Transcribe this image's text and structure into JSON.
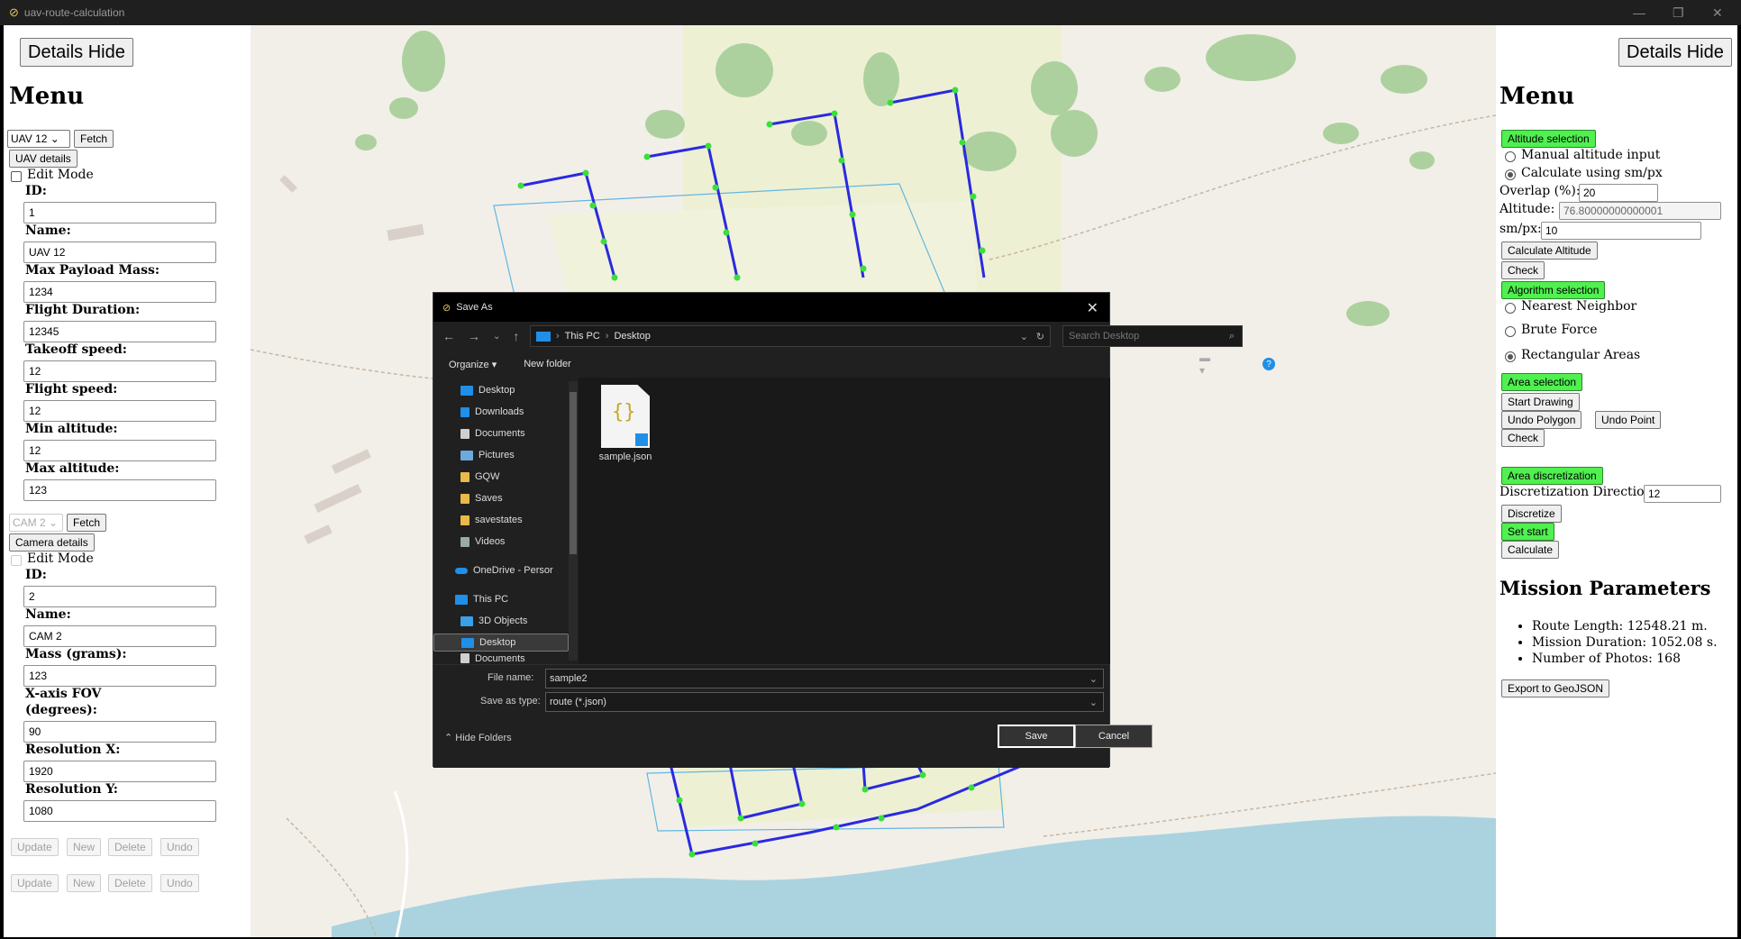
{
  "window": {
    "title": "uav-route-calculation"
  },
  "left": {
    "details_hide": "Details Hide",
    "menu_title": "Menu",
    "uav_select": "UAV 12",
    "fetch": "Fetch",
    "uav_details": "UAV details",
    "edit_mode": "Edit Mode",
    "uav_fields": [
      {
        "label": "ID:",
        "value": "1"
      },
      {
        "label": "Name:",
        "value": "UAV 12"
      },
      {
        "label": "Max Payload Mass:",
        "value": "1234"
      },
      {
        "label": "Flight Duration:",
        "value": "12345"
      },
      {
        "label": "Takeoff speed:",
        "value": "12"
      },
      {
        "label": "Flight speed:",
        "value": "12"
      },
      {
        "label": "Min altitude:",
        "value": "12"
      },
      {
        "label": "Max altitude:",
        "value": "123"
      }
    ],
    "cam_select": "CAM 2",
    "camera_details": "Camera details",
    "cam_fields": {
      "id_label": "ID:",
      "id_value": "2",
      "name_label": "Name:",
      "name_value": "CAM 2",
      "mass_label": "Mass (grams):",
      "mass_value": "123",
      "fov_label_1": "X-axis FOV",
      "fov_label_2": "(degrees):",
      "fov_value": "90",
      "resx_label": "Resolution X:",
      "resx_value": "1920",
      "resy_label": "Resolution Y:",
      "resy_value": "1080"
    },
    "actions": [
      "Update",
      "New",
      "Delete",
      "Undo"
    ]
  },
  "right": {
    "details_hide": "Details Hide",
    "menu_title": "Menu",
    "altitude_selection": "Altitude selection",
    "manual_altitude": "Manual altitude input",
    "calc_smpx": "Calculate using sm/px",
    "overlap_label": "Overlap (%):",
    "overlap_value": "20",
    "altitude_label": "Altitude:",
    "altitude_value": "76.80000000000001",
    "smpx_label": "sm/px:",
    "smpx_value": "10",
    "calculate_altitude": "Calculate Altitude",
    "check": "Check",
    "algorithm_selection": "Algorithm selection",
    "nearest_neighbor": "Nearest Neighbor",
    "brute_force": "Brute Force",
    "rectangular_areas": "Rectangular Areas",
    "area_selection": "Area selection",
    "start_drawing": "Start Drawing",
    "undo_polygon": "Undo Polygon",
    "undo_point": "Undo Point",
    "area_discretization": "Area discretization",
    "disc_direction_label": "Discretization Direction:",
    "disc_direction_value": "12",
    "discretize": "Discretize",
    "set_start": "Set start",
    "calculate": "Calculate",
    "mission_title": "Mission Parameters",
    "mission_items": [
      "Route Length: 12548.21 m.",
      "Mission Duration: 1052.08 s.",
      "Number of Photos: 168"
    ],
    "export": "Export to GeoJSON"
  },
  "dialog": {
    "title": "Save As",
    "crumbs": [
      "This PC",
      "Desktop"
    ],
    "search_placeholder": "Search Desktop",
    "organize": "Organize",
    "new_folder": "New folder",
    "tree": [
      "Desktop",
      "Downloads",
      "Documents",
      "Pictures",
      "GQW",
      "Saves",
      "savestates",
      "Videos",
      "OneDrive - Persor",
      "This PC",
      "3D Objects",
      "Desktop",
      "Documents"
    ],
    "file_name": "sample.json",
    "file_name_label": "File name:",
    "file_name_value": "sample2",
    "save_type_label": "Save as type:",
    "save_type_value": "route (*.json)",
    "hide_folders": "Hide Folders",
    "save": "Save",
    "cancel": "Cancel"
  },
  "colors": {
    "accent_green": "#4ff04f",
    "route": "#2a2ae0",
    "waypoint": "#3adf3a"
  }
}
